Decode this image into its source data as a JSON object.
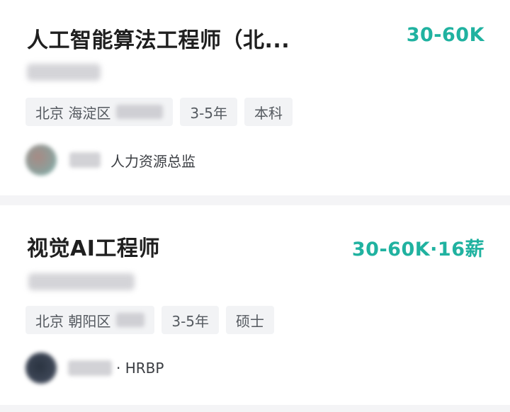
{
  "jobs": [
    {
      "title": "人工智能算法工程师（北...",
      "salary": "30-60K",
      "tags": {
        "location": "北京 海淀区",
        "experience": "3-5年",
        "education": "本科"
      },
      "recruiter_role": "人力资源总监"
    },
    {
      "title": "视觉AI工程师",
      "salary": "30-60K·16薪",
      "tags": {
        "location": "北京 朝阳区",
        "experience": "3-5年",
        "education": "硕士"
      },
      "recruiter_role": "· HRBP"
    }
  ],
  "colors": {
    "salary": "#20b2a0",
    "title": "#1f1f1f",
    "tag_bg": "#f2f3f5",
    "page_bg": "#f4f4f6"
  }
}
